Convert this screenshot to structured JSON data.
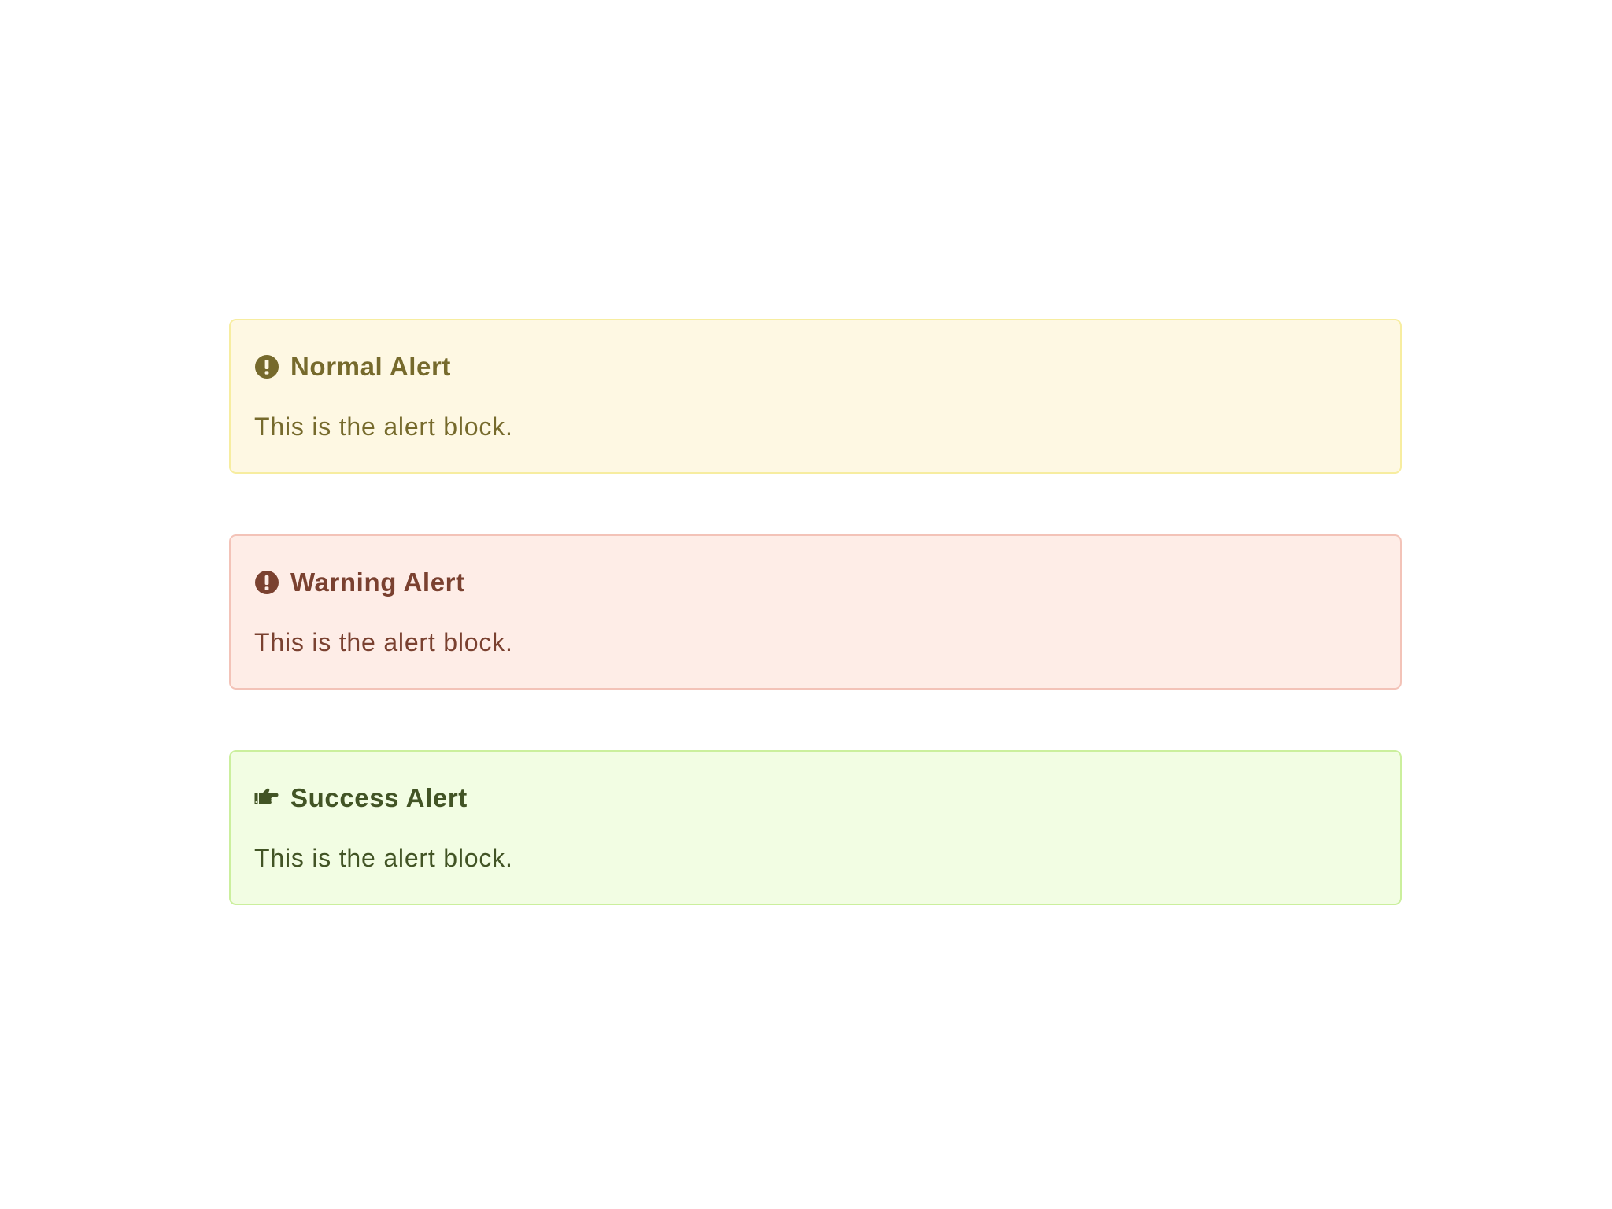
{
  "alerts": [
    {
      "variant": "normal",
      "icon": "exclamation-circle-icon",
      "title": "Normal Alert",
      "body": "This is the alert block.",
      "colors": {
        "background": "#fef8e3",
        "border": "#f7eda0",
        "text": "#766a2c"
      }
    },
    {
      "variant": "warning",
      "icon": "exclamation-circle-icon",
      "title": "Warning Alert",
      "body": "This is the alert block.",
      "colors": {
        "background": "#feede7",
        "border": "#f3c3b8",
        "text": "#7a4130"
      }
    },
    {
      "variant": "success",
      "icon": "hand-point-right-icon",
      "title": "Success Alert",
      "body": "This is the alert block.",
      "colors": {
        "background": "#f2fde3",
        "border": "#cbef9d",
        "text": "#425425"
      }
    }
  ]
}
